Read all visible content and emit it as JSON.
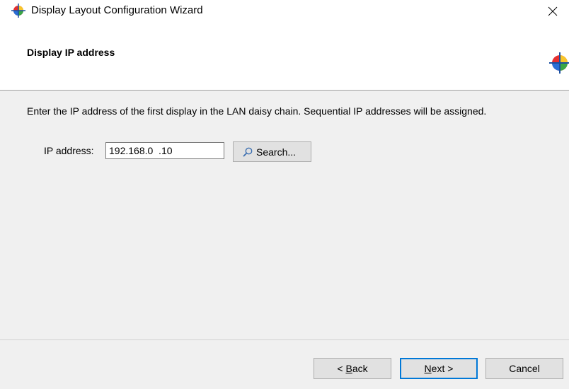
{
  "window": {
    "title": "Display Layout Configuration Wizard",
    "close_glyph": "✕"
  },
  "header": {
    "title": "Display IP address"
  },
  "body": {
    "instructions": "Enter the IP address of the first display in the LAN daisy chain. Sequential IP addresses will be assigned.",
    "ip_label": "IP address:",
    "ip_value": "192.168.0  .10",
    "search_label": "Search..."
  },
  "footer": {
    "back": {
      "mnemonic": "B",
      "rest": "ack",
      "prefix": "< "
    },
    "next": {
      "mnemonic": "N",
      "rest": "ext",
      "suffix": " >"
    },
    "cancel": "Cancel"
  },
  "icons": {
    "app": "color-wheel-icon",
    "search": "magnifier-icon",
    "close": "close-icon"
  },
  "colors": {
    "accent": "#0078d7",
    "body_bg": "#f0f0f0"
  }
}
